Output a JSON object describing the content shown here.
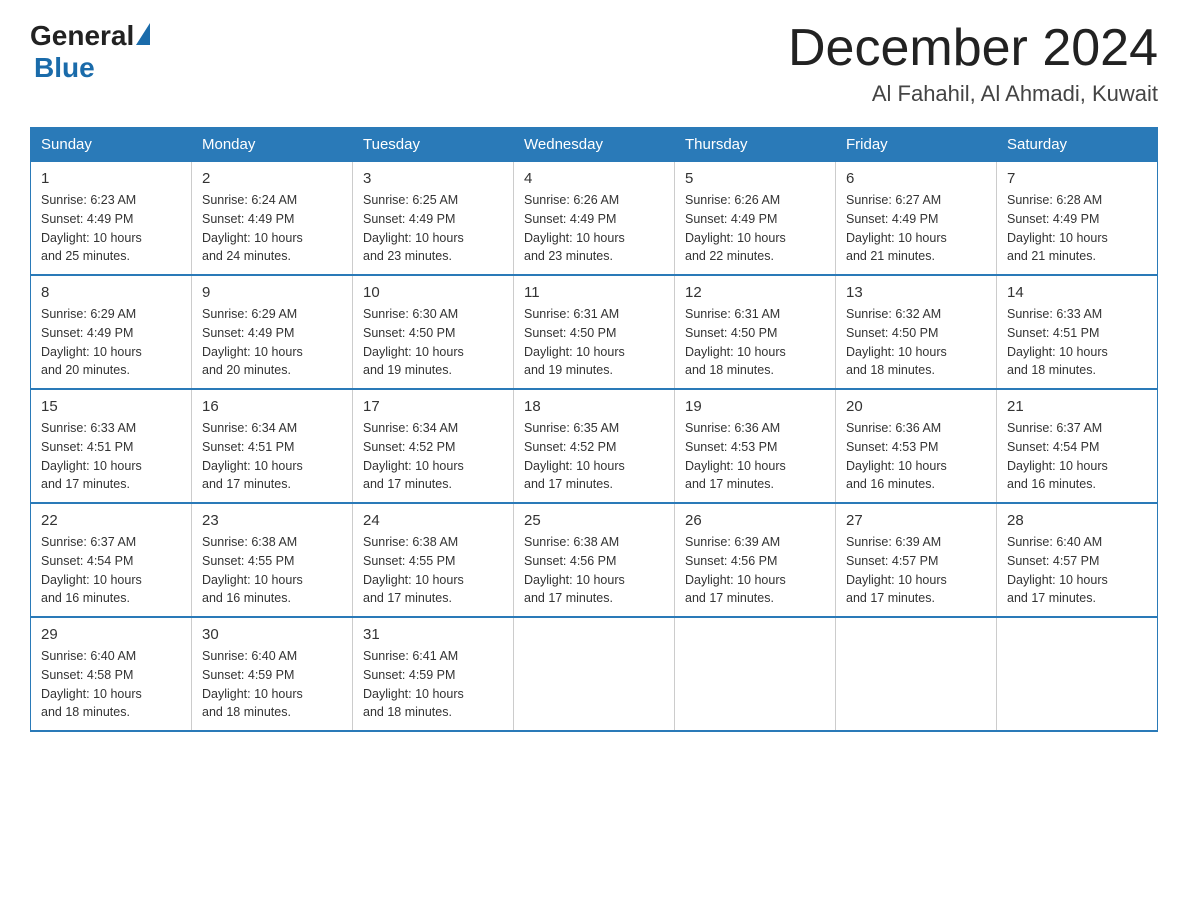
{
  "logo": {
    "text_general": "General",
    "text_blue": "Blue",
    "triangle_char": "▶"
  },
  "header": {
    "month_year": "December 2024",
    "location": "Al Fahahil, Al Ahmadi, Kuwait"
  },
  "days_of_week": [
    "Sunday",
    "Monday",
    "Tuesday",
    "Wednesday",
    "Thursday",
    "Friday",
    "Saturday"
  ],
  "weeks": [
    [
      {
        "day": "1",
        "sunrise": "Sunrise: 6:23 AM",
        "sunset": "Sunset: 4:49 PM",
        "daylight": "Daylight: 10 hours",
        "daylight2": "and 25 minutes."
      },
      {
        "day": "2",
        "sunrise": "Sunrise: 6:24 AM",
        "sunset": "Sunset: 4:49 PM",
        "daylight": "Daylight: 10 hours",
        "daylight2": "and 24 minutes."
      },
      {
        "day": "3",
        "sunrise": "Sunrise: 6:25 AM",
        "sunset": "Sunset: 4:49 PM",
        "daylight": "Daylight: 10 hours",
        "daylight2": "and 23 minutes."
      },
      {
        "day": "4",
        "sunrise": "Sunrise: 6:26 AM",
        "sunset": "Sunset: 4:49 PM",
        "daylight": "Daylight: 10 hours",
        "daylight2": "and 23 minutes."
      },
      {
        "day": "5",
        "sunrise": "Sunrise: 6:26 AM",
        "sunset": "Sunset: 4:49 PM",
        "daylight": "Daylight: 10 hours",
        "daylight2": "and 22 minutes."
      },
      {
        "day": "6",
        "sunrise": "Sunrise: 6:27 AM",
        "sunset": "Sunset: 4:49 PM",
        "daylight": "Daylight: 10 hours",
        "daylight2": "and 21 minutes."
      },
      {
        "day": "7",
        "sunrise": "Sunrise: 6:28 AM",
        "sunset": "Sunset: 4:49 PM",
        "daylight": "Daylight: 10 hours",
        "daylight2": "and 21 minutes."
      }
    ],
    [
      {
        "day": "8",
        "sunrise": "Sunrise: 6:29 AM",
        "sunset": "Sunset: 4:49 PM",
        "daylight": "Daylight: 10 hours",
        "daylight2": "and 20 minutes."
      },
      {
        "day": "9",
        "sunrise": "Sunrise: 6:29 AM",
        "sunset": "Sunset: 4:49 PM",
        "daylight": "Daylight: 10 hours",
        "daylight2": "and 20 minutes."
      },
      {
        "day": "10",
        "sunrise": "Sunrise: 6:30 AM",
        "sunset": "Sunset: 4:50 PM",
        "daylight": "Daylight: 10 hours",
        "daylight2": "and 19 minutes."
      },
      {
        "day": "11",
        "sunrise": "Sunrise: 6:31 AM",
        "sunset": "Sunset: 4:50 PM",
        "daylight": "Daylight: 10 hours",
        "daylight2": "and 19 minutes."
      },
      {
        "day": "12",
        "sunrise": "Sunrise: 6:31 AM",
        "sunset": "Sunset: 4:50 PM",
        "daylight": "Daylight: 10 hours",
        "daylight2": "and 18 minutes."
      },
      {
        "day": "13",
        "sunrise": "Sunrise: 6:32 AM",
        "sunset": "Sunset: 4:50 PM",
        "daylight": "Daylight: 10 hours",
        "daylight2": "and 18 minutes."
      },
      {
        "day": "14",
        "sunrise": "Sunrise: 6:33 AM",
        "sunset": "Sunset: 4:51 PM",
        "daylight": "Daylight: 10 hours",
        "daylight2": "and 18 minutes."
      }
    ],
    [
      {
        "day": "15",
        "sunrise": "Sunrise: 6:33 AM",
        "sunset": "Sunset: 4:51 PM",
        "daylight": "Daylight: 10 hours",
        "daylight2": "and 17 minutes."
      },
      {
        "day": "16",
        "sunrise": "Sunrise: 6:34 AM",
        "sunset": "Sunset: 4:51 PM",
        "daylight": "Daylight: 10 hours",
        "daylight2": "and 17 minutes."
      },
      {
        "day": "17",
        "sunrise": "Sunrise: 6:34 AM",
        "sunset": "Sunset: 4:52 PM",
        "daylight": "Daylight: 10 hours",
        "daylight2": "and 17 minutes."
      },
      {
        "day": "18",
        "sunrise": "Sunrise: 6:35 AM",
        "sunset": "Sunset: 4:52 PM",
        "daylight": "Daylight: 10 hours",
        "daylight2": "and 17 minutes."
      },
      {
        "day": "19",
        "sunrise": "Sunrise: 6:36 AM",
        "sunset": "Sunset: 4:53 PM",
        "daylight": "Daylight: 10 hours",
        "daylight2": "and 17 minutes."
      },
      {
        "day": "20",
        "sunrise": "Sunrise: 6:36 AM",
        "sunset": "Sunset: 4:53 PM",
        "daylight": "Daylight: 10 hours",
        "daylight2": "and 16 minutes."
      },
      {
        "day": "21",
        "sunrise": "Sunrise: 6:37 AM",
        "sunset": "Sunset: 4:54 PM",
        "daylight": "Daylight: 10 hours",
        "daylight2": "and 16 minutes."
      }
    ],
    [
      {
        "day": "22",
        "sunrise": "Sunrise: 6:37 AM",
        "sunset": "Sunset: 4:54 PM",
        "daylight": "Daylight: 10 hours",
        "daylight2": "and 16 minutes."
      },
      {
        "day": "23",
        "sunrise": "Sunrise: 6:38 AM",
        "sunset": "Sunset: 4:55 PM",
        "daylight": "Daylight: 10 hours",
        "daylight2": "and 16 minutes."
      },
      {
        "day": "24",
        "sunrise": "Sunrise: 6:38 AM",
        "sunset": "Sunset: 4:55 PM",
        "daylight": "Daylight: 10 hours",
        "daylight2": "and 17 minutes."
      },
      {
        "day": "25",
        "sunrise": "Sunrise: 6:38 AM",
        "sunset": "Sunset: 4:56 PM",
        "daylight": "Daylight: 10 hours",
        "daylight2": "and 17 minutes."
      },
      {
        "day": "26",
        "sunrise": "Sunrise: 6:39 AM",
        "sunset": "Sunset: 4:56 PM",
        "daylight": "Daylight: 10 hours",
        "daylight2": "and 17 minutes."
      },
      {
        "day": "27",
        "sunrise": "Sunrise: 6:39 AM",
        "sunset": "Sunset: 4:57 PM",
        "daylight": "Daylight: 10 hours",
        "daylight2": "and 17 minutes."
      },
      {
        "day": "28",
        "sunrise": "Sunrise: 6:40 AM",
        "sunset": "Sunset: 4:57 PM",
        "daylight": "Daylight: 10 hours",
        "daylight2": "and 17 minutes."
      }
    ],
    [
      {
        "day": "29",
        "sunrise": "Sunrise: 6:40 AM",
        "sunset": "Sunset: 4:58 PM",
        "daylight": "Daylight: 10 hours",
        "daylight2": "and 18 minutes."
      },
      {
        "day": "30",
        "sunrise": "Sunrise: 6:40 AM",
        "sunset": "Sunset: 4:59 PM",
        "daylight": "Daylight: 10 hours",
        "daylight2": "and 18 minutes."
      },
      {
        "day": "31",
        "sunrise": "Sunrise: 6:41 AM",
        "sunset": "Sunset: 4:59 PM",
        "daylight": "Daylight: 10 hours",
        "daylight2": "and 18 minutes."
      },
      null,
      null,
      null,
      null
    ]
  ]
}
